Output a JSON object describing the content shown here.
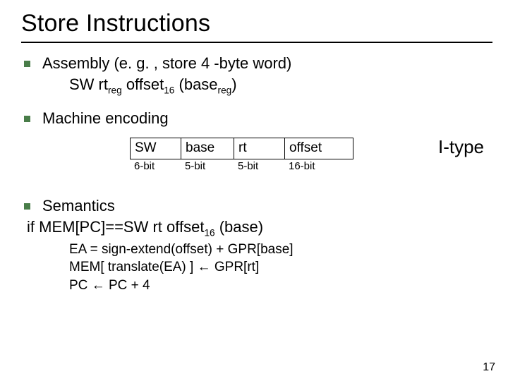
{
  "title": "Store Instructions",
  "bullet1": "Assembly (e. g. , store 4 -byte word)",
  "syntax_prefix": "SW rt",
  "syntax_sub1": "reg",
  "syntax_mid": " offset",
  "syntax_sub2": "16",
  "syntax_mid2": " (base",
  "syntax_sub3": "reg",
  "syntax_suffix": ")",
  "bullet2": "Machine encoding",
  "enc": {
    "f0": "SW",
    "b0": "6-bit",
    "f1": "base",
    "b1": "5-bit",
    "f2": "rt",
    "b2": "5-bit",
    "f3": "offset",
    "b3": "16-bit"
  },
  "itype": "I-type",
  "bullet3": "Semantics",
  "sem_if_a": "if MEM[PC]==SW rt offset",
  "sem_if_sub": "16",
  "sem_if_b": " (base)",
  "sem1": "EA = sign-extend(offset) + GPR[base]",
  "sem2a": "MEM[ translate(EA) ] ",
  "sem2b": " GPR[rt]",
  "sem3a": "PC ",
  "sem3b": " PC + 4",
  "arrow": "←",
  "page": "17"
}
